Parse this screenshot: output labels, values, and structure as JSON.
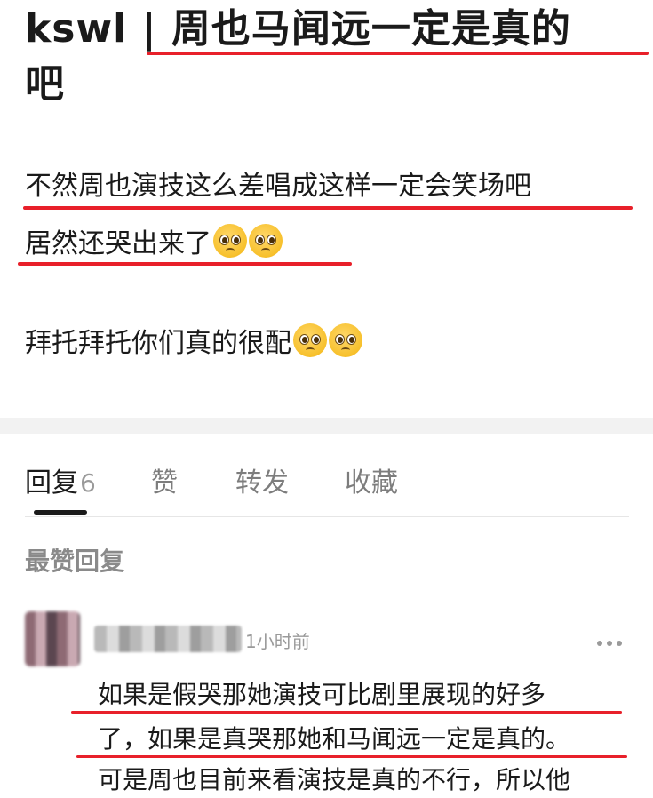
{
  "post": {
    "title": "kswl | 周也马闻远一定是真的吧",
    "title_line1_prefix": "kswl | ",
    "title_line1_highlight": "周也马闻远一定是真的",
    "title_line2": "吧",
    "body_line1": "不然周也演技这么差唱成这样一定会笑场吧",
    "body_line2": "居然还哭出来了",
    "body_line3": "拜托拜托你们真的很配",
    "emoji_name": "pleading-face-icon"
  },
  "tabs": [
    {
      "label": "回复",
      "count": "6",
      "active": true
    },
    {
      "label": "赞",
      "count": "",
      "active": false
    },
    {
      "label": "转发",
      "count": "",
      "active": false
    },
    {
      "label": "收藏",
      "count": "",
      "active": false
    }
  ],
  "section_label": "最赞回复",
  "comment": {
    "time": "1小时前",
    "line1": "如果是假哭那她演技可比剧里展现的好多",
    "line2": "了，如果是真哭那她和马闻远一定是真的。",
    "line3": "可是周也目前来看演技是真的不行，所以他"
  },
  "colors": {
    "highlight_underline": "#e8202a",
    "text": "#1a1a1a",
    "muted": "#7d7d7d"
  }
}
